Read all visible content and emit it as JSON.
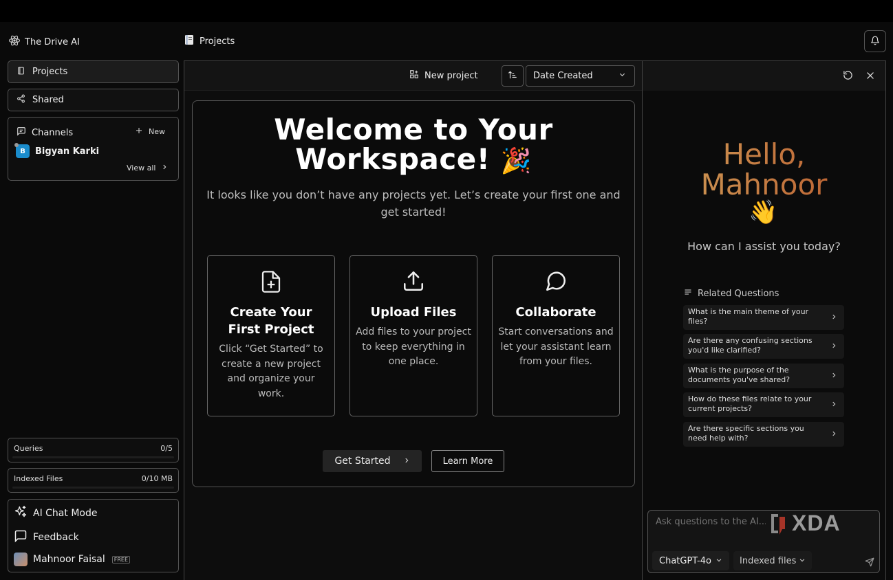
{
  "app": {
    "brand": "The Drive AI",
    "breadcrumb": "Projects"
  },
  "sidebar": {
    "projects_label": "Projects",
    "shared_label": "Shared",
    "channels": {
      "title": "Channels",
      "new_label": "New",
      "user_initial": "B",
      "user_name": "Bigyan Karki",
      "view_all": "View all"
    },
    "queries": {
      "label": "Queries",
      "value": "0/5",
      "used_fraction": 0
    },
    "indexed_files": {
      "label": "Indexed Files",
      "value": "0/10 MB",
      "used_fraction": 0
    },
    "ai_chat_mode": "AI Chat Mode",
    "feedback": "Feedback",
    "user_name": "Mahnoor Faisal",
    "plan_badge": "FREE"
  },
  "toolbar": {
    "new_project": "New project",
    "sort_select": "Date Created"
  },
  "welcome": {
    "title_line1": "Welcome to Your",
    "title_line2": "Workspace!",
    "title_emoji": "🎉",
    "subtitle": "It looks like you don’t have any projects yet. Let’s create your first one and get started!",
    "cards": [
      {
        "title": "Create Your First Project",
        "desc": "Click “Get Started” to create a new project and organize your work.",
        "icon": "file-plus-icon"
      },
      {
        "title": "Upload Files",
        "desc": "Add files to your project to keep everything in one place.",
        "icon": "upload-icon"
      },
      {
        "title": "Collaborate",
        "desc": "Start conversations and let your assistant learn from your files.",
        "icon": "chat-bubble-icon"
      }
    ],
    "get_started": "Get Started",
    "learn_more": "Learn More"
  },
  "assistant": {
    "greeting_line1": "Hello,",
    "greeting_line2": "Mahnoor",
    "wave_emoji": "👋",
    "prompt": "How can I assist you today?",
    "related_title": "Related Questions",
    "questions": [
      "What is the main theme of your files?",
      "Are there any confusing sections you'd like clarified?",
      "What is the purpose of the documents you've shared?",
      "How do these files relate to your current projects?",
      "Are there specific sections you need help with?"
    ],
    "input_placeholder": "Ask questions to the AI...",
    "watermark": "XDA",
    "model": "ChatGPT-4o",
    "source": "Indexed files"
  },
  "colors": {
    "background": "#0a0a0a",
    "greeting_gradient_start": "#d0a15b",
    "greeting_gradient_end": "#b9562a",
    "avatar_blue": "#1a8ccc"
  }
}
